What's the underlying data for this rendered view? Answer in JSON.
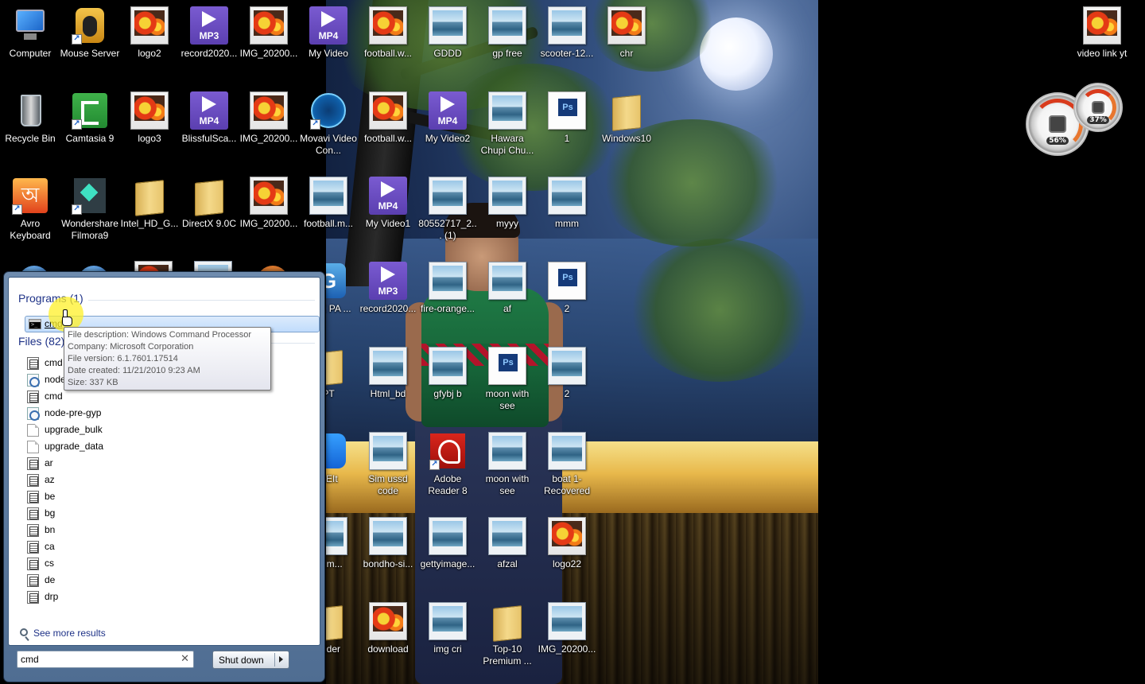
{
  "desktop": {
    "icons": [
      {
        "label": "Computer",
        "kind": "computer"
      },
      {
        "label": "Mouse Server",
        "kind": "mouse"
      },
      {
        "label": "logo2",
        "kind": "photo"
      },
      {
        "label": "record2020...",
        "kind": "mp3",
        "tag": "MP3"
      },
      {
        "label": "IMG_20200...",
        "kind": "photo"
      },
      {
        "label": "My Video",
        "kind": "mp4",
        "tag": "MP4"
      },
      {
        "label": "football.w...",
        "kind": "photo"
      },
      {
        "label": "GDDD",
        "kind": "landscape"
      },
      {
        "label": "gp free",
        "kind": "landscape"
      },
      {
        "label": "scooter-12...",
        "kind": "landscape"
      },
      {
        "label": "chr",
        "kind": "photo"
      },
      {
        "label": "Recycle Bin",
        "kind": "recycle"
      },
      {
        "label": "Camtasia 9",
        "kind": "camtasia"
      },
      {
        "label": "logo3",
        "kind": "photo"
      },
      {
        "label": "BlissfulSca...",
        "kind": "mp4",
        "tag": "MP4"
      },
      {
        "label": "IMG_20200...",
        "kind": "photo"
      },
      {
        "label": "Movavi Video Con...",
        "kind": "movavi"
      },
      {
        "label": "football.w...",
        "kind": "photo"
      },
      {
        "label": "My Video2",
        "kind": "mp4",
        "tag": "MP4"
      },
      {
        "label": "Hawara Chupi Chu...",
        "kind": "landscape"
      },
      {
        "label": "1",
        "kind": "ps",
        "tag": "Ps"
      },
      {
        "label": "Windows10",
        "kind": "folder"
      },
      {
        "label": "Avro Keyboard",
        "kind": "avro",
        "tag": "অ"
      },
      {
        "label": "Wondershare Filmora9",
        "kind": "filmora"
      },
      {
        "label": "Intel_HD_G...",
        "kind": "folder"
      },
      {
        "label": "DirectX 9.0C",
        "kind": "folder"
      },
      {
        "label": "IMG_20200...",
        "kind": "photo"
      },
      {
        "label": "football.m...",
        "kind": "landscape"
      },
      {
        "label": "My Video1",
        "kind": "mp4",
        "tag": "MP4"
      },
      {
        "label": "80552717_2... (1)",
        "kind": "landscape"
      },
      {
        "label": "myyy",
        "kind": "landscape"
      },
      {
        "label": "mmm",
        "kind": "landscape"
      },
      {
        "label": "LiNK PA ...",
        "kind": "link",
        "tag": "G"
      },
      {
        "label": "record2020...",
        "kind": "mp3",
        "tag": "MP3"
      },
      {
        "label": "fire-orange...",
        "kind": "landscape"
      },
      {
        "label": "af",
        "kind": "landscape"
      },
      {
        "label": "2",
        "kind": "ps",
        "tag": "Ps"
      },
      {
        "label": "PT",
        "kind": "folder"
      },
      {
        "label": "Html_bd",
        "kind": "landscape"
      },
      {
        "label": "gfybj b",
        "kind": "landscape"
      },
      {
        "label": "moon with see",
        "kind": "ps",
        "tag": "Ps"
      },
      {
        "label": "2",
        "kind": "landscape"
      },
      {
        "label": "REIt",
        "kind": "shareit"
      },
      {
        "label": "Sim ussd code",
        "kind": "landscape"
      },
      {
        "label": "Adobe Reader 8",
        "kind": "adobe"
      },
      {
        "label": "moon with see",
        "kind": "landscape"
      },
      {
        "label": "boat 1-Recovered",
        "kind": "landscape"
      },
      {
        "label": "all.m...",
        "kind": "landscape"
      },
      {
        "label": "bondho-si...",
        "kind": "landscape"
      },
      {
        "label": "gettyimage...",
        "kind": "landscape"
      },
      {
        "label": "afzal",
        "kind": "landscape"
      },
      {
        "label": "logo22",
        "kind": "photo"
      },
      {
        "label": "folder",
        "kind": "folder"
      },
      {
        "label": "download",
        "kind": "photo"
      },
      {
        "label": "img cri",
        "kind": "landscape"
      },
      {
        "label": "Top-10 Premium ...",
        "kind": "folder"
      },
      {
        "label": "IMG_20200...",
        "kind": "landscape"
      },
      {
        "label": "video link yt",
        "kind": "photo"
      }
    ]
  },
  "gadget": {
    "cpu_percent": "56%",
    "ram_percent": "37%"
  },
  "start_menu": {
    "programs_header": "Programs (1)",
    "selected_program": "cmd",
    "files_header": "Files (82)",
    "files": [
      {
        "name": "cmd",
        "icon": "batch-file-icon"
      },
      {
        "name": "node-",
        "icon": "config-file-icon"
      },
      {
        "name": "cmd",
        "icon": "batch-file-icon"
      },
      {
        "name": "node-pre-gyp",
        "icon": "config-file-icon"
      },
      {
        "name": "upgrade_bulk",
        "icon": "blank-file-icon"
      },
      {
        "name": "upgrade_data",
        "icon": "blank-file-icon"
      },
      {
        "name": "ar",
        "icon": "batch-file-icon"
      },
      {
        "name": "az",
        "icon": "batch-file-icon"
      },
      {
        "name": "be",
        "icon": "batch-file-icon"
      },
      {
        "name": "bg",
        "icon": "batch-file-icon"
      },
      {
        "name": "bn",
        "icon": "batch-file-icon"
      },
      {
        "name": "ca",
        "icon": "batch-file-icon"
      },
      {
        "name": "cs",
        "icon": "batch-file-icon"
      },
      {
        "name": "de",
        "icon": "batch-file-icon"
      },
      {
        "name": "drp",
        "icon": "batch-file-icon"
      }
    ],
    "see_more": "See more results",
    "search_value": "cmd",
    "shutdown_label": "Shut down",
    "tooltip": {
      "description": "File description: Windows Command Processor",
      "company": "Company: Microsoft Corporation",
      "version": "File version: 6.1.7601.17514",
      "created": "Date created: 11/21/2010 9:23 AM",
      "size": "Size: 337 KB"
    }
  }
}
